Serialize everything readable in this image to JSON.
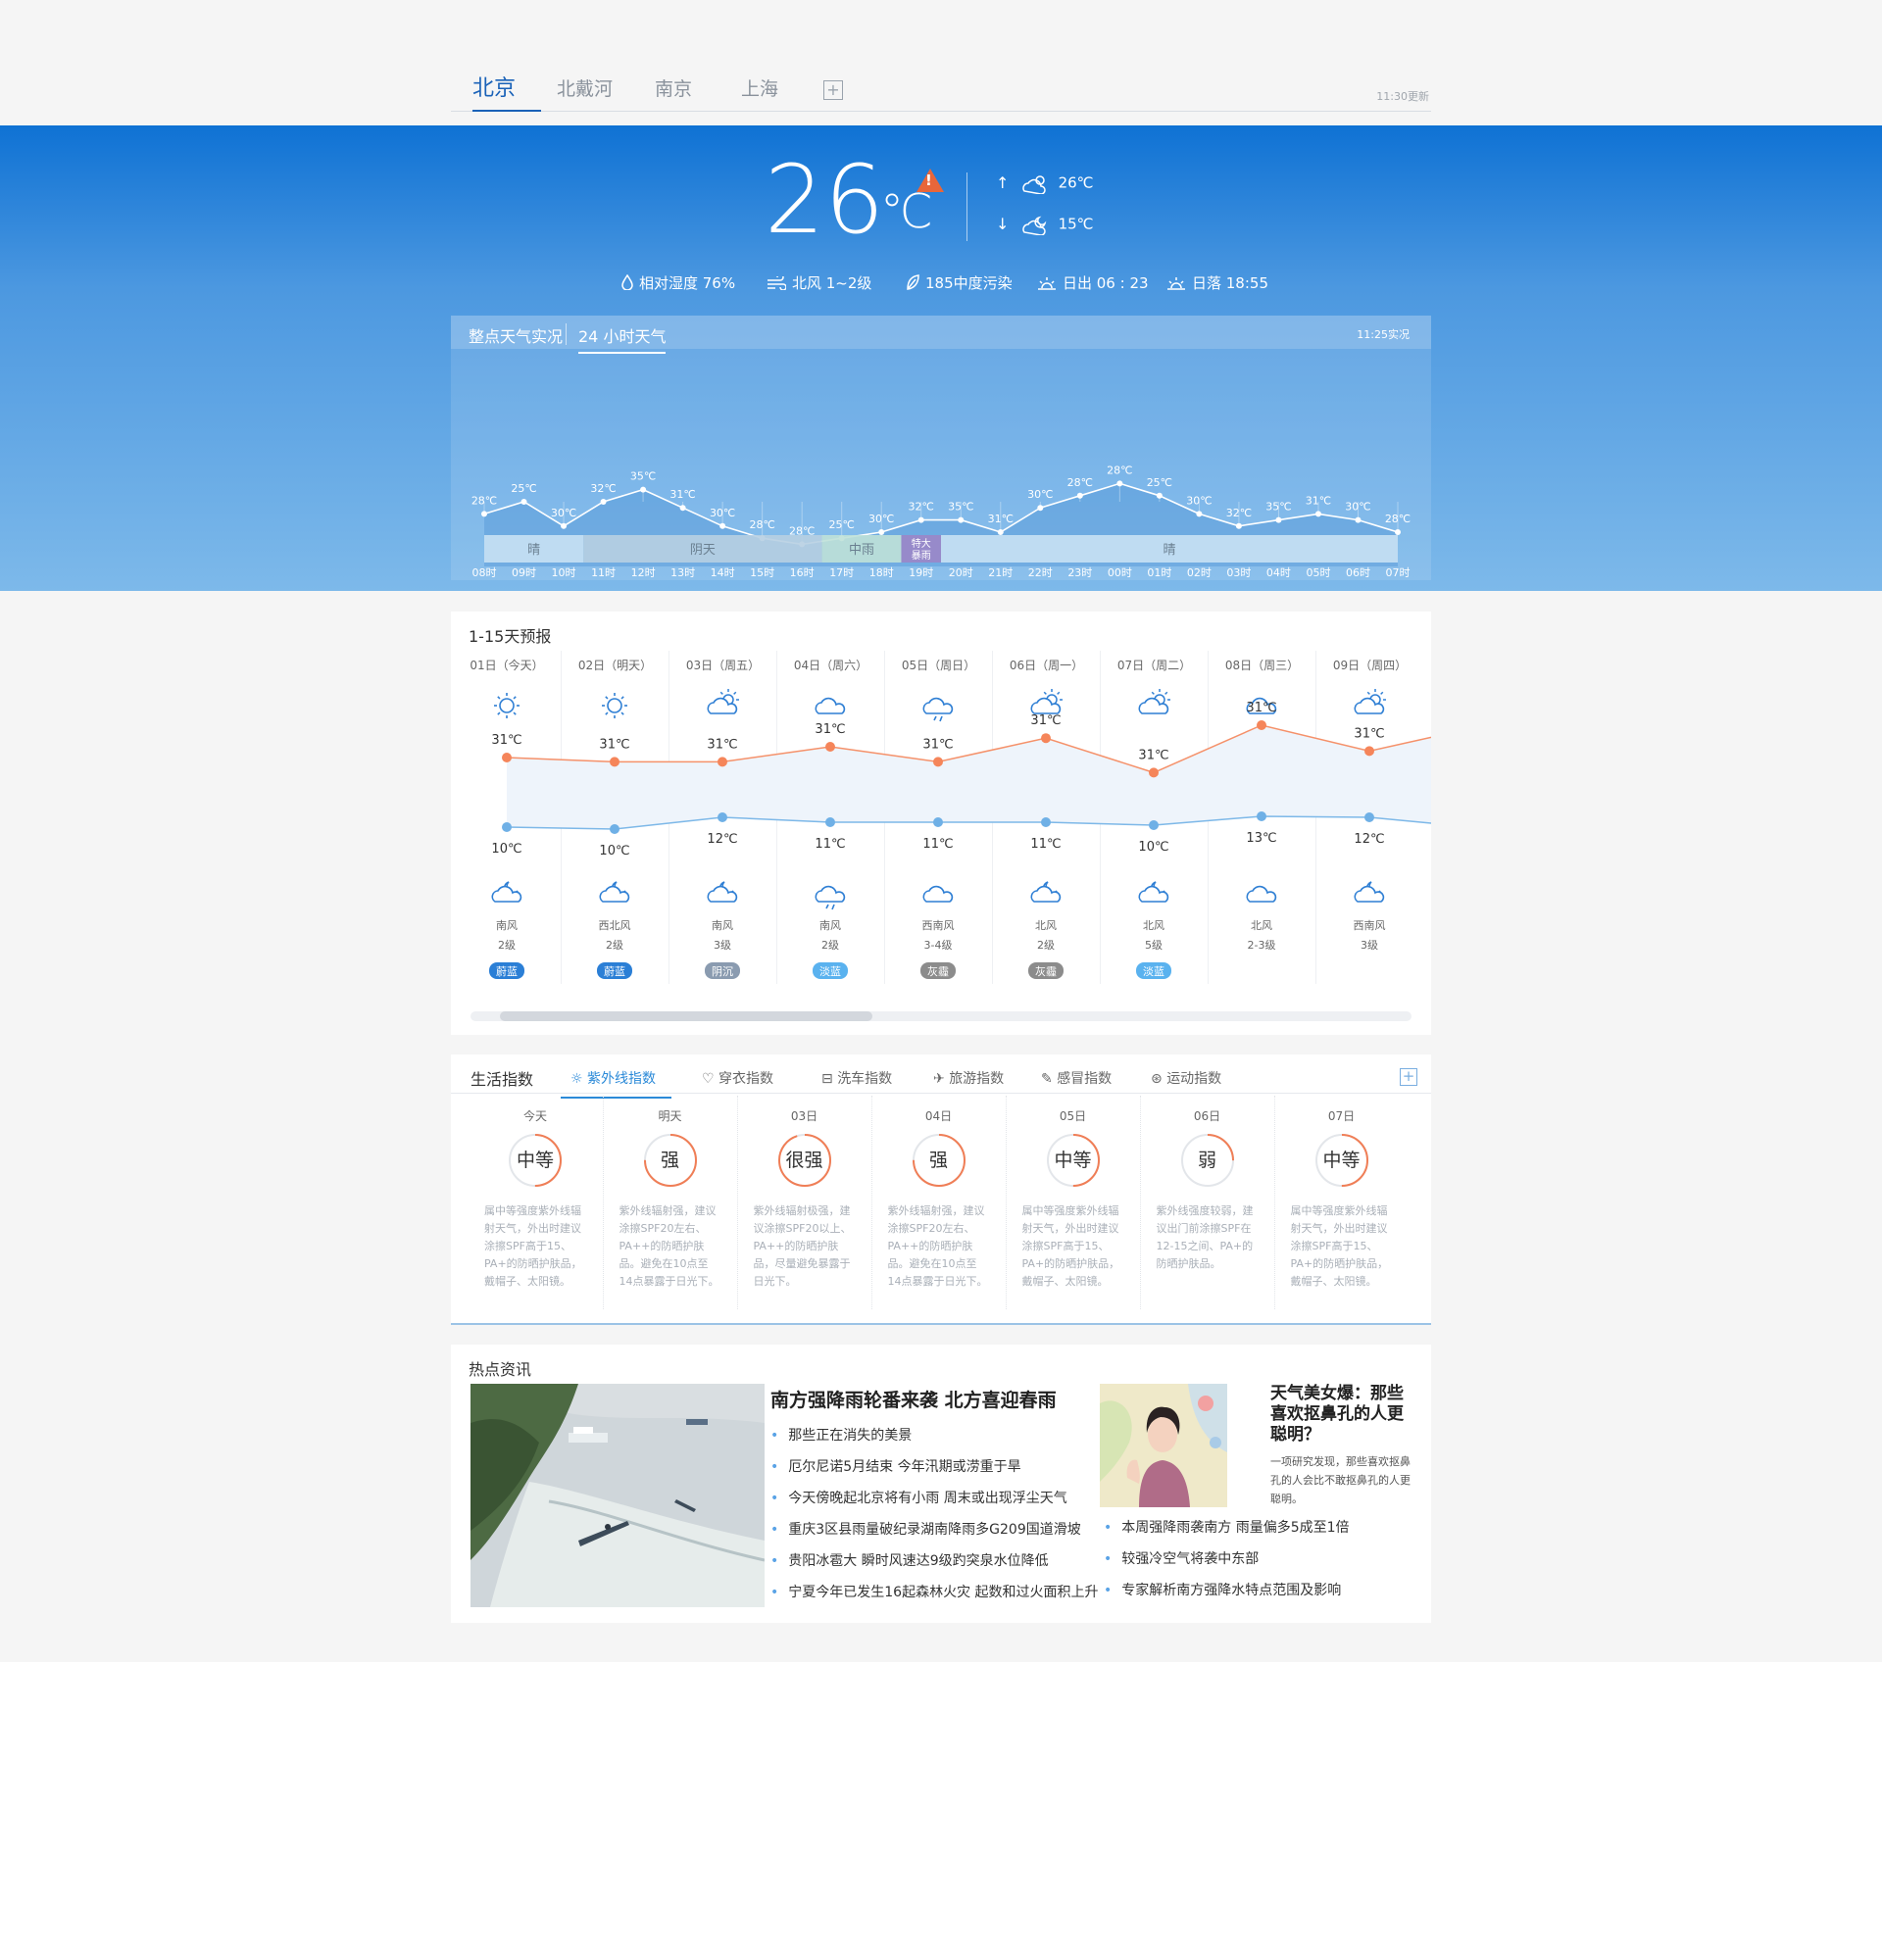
{
  "city_tabs": [
    "北京",
    "北戴河",
    "南京",
    "上海"
  ],
  "updated": "11:30更新",
  "current": {
    "temp": "26",
    "unit": "℃",
    "high": "26℃",
    "low": "15℃"
  },
  "metrics": {
    "humidity": "相对湿度  76%",
    "wind": "北风  1~2级",
    "air": "185中度污染",
    "sunrise": "日出 06 : 23",
    "sunset": "日落 18:55"
  },
  "hourly": {
    "tabs": [
      "整点天气实况",
      "24 小时天气"
    ],
    "observed": "11:25实况",
    "hours": [
      "08时",
      "09时",
      "10时",
      "11时",
      "12时",
      "13时",
      "14时",
      "15时",
      "16时",
      "17时",
      "18时",
      "19时",
      "20时",
      "21时",
      "22时",
      "23时",
      "00时",
      "01时",
      "02时",
      "03时",
      "04时",
      "05时",
      "06时",
      "07时"
    ],
    "temps": [
      28,
      25,
      30,
      32,
      35,
      31,
      30,
      28,
      28,
      25,
      30,
      32,
      35,
      31,
      30,
      28,
      28,
      25,
      30,
      32,
      35,
      31,
      30,
      28
    ],
    "plot_y": [
      28,
      30,
      26,
      30,
      32,
      29,
      26,
      24,
      23,
      24,
      25,
      27,
      27,
      25,
      29,
      31,
      33,
      31,
      28,
      26,
      27,
      28,
      27,
      25
    ],
    "labels": [
      "28℃",
      "25℃",
      "30℃",
      "32℃",
      "35℃",
      "31℃",
      "30℃",
      "28℃",
      "28℃",
      "25℃",
      "30℃",
      "32℃",
      "35℃",
      "31℃",
      "30℃",
      "28℃",
      "28℃",
      "25℃",
      "30℃",
      "32℃",
      "35℃",
      "31℃",
      "30℃",
      "28℃"
    ],
    "conditions": [
      {
        "label": "晴",
        "start": 0,
        "end": 3,
        "color": "#c8e1f4"
      },
      {
        "label": "阴天",
        "start": 3,
        "end": 9,
        "color": "#b7cfe2"
      },
      {
        "label": "中雨",
        "start": 9,
        "end": 11,
        "color": "#bfe1d8"
      },
      {
        "label": "特大暴雨",
        "start": 11,
        "end": 12,
        "color": "#9b86c8"
      },
      {
        "label": "晴",
        "start": 12,
        "end": 24,
        "color": "#c8e1f4"
      }
    ]
  },
  "forecast": {
    "title": "1-15天预报",
    "days": [
      {
        "date": "01日（今天）",
        "day_icon": "sun-icon",
        "high": "31℃",
        "high_v": 31.0,
        "low": "10℃",
        "low_v": 10,
        "night_icon": "cloud-moon-icon",
        "wind": "南风",
        "level": "2级",
        "badge": "蔚蓝",
        "badge_color": "#2b7fd6"
      },
      {
        "date": "02日（明天）",
        "day_icon": "sun-icon",
        "high": "31℃",
        "high_v": 30.6,
        "low": "10℃",
        "low_v": 9.6,
        "night_icon": "cloud-moon-icon",
        "wind": "西北风",
        "level": "2级",
        "badge": "蔚蓝",
        "badge_color": "#2b7fd6"
      },
      {
        "date": "03日（周五）",
        "day_icon": "partly-cloudy-icon",
        "high": "31℃",
        "high_v": 30.6,
        "low": "12℃",
        "low_v": 12,
        "night_icon": "cloud-moon-icon",
        "wind": "南风",
        "level": "3级",
        "badge": "阴沉",
        "badge_color": "#8a9bb0"
      },
      {
        "date": "04日（周六）",
        "day_icon": "cloud-icon",
        "high": "31℃",
        "high_v": 32,
        "low": "11℃",
        "low_v": 11,
        "night_icon": "rain-icon",
        "wind": "南风",
        "level": "2级",
        "badge": "淡蓝",
        "badge_color": "#5ab2ef"
      },
      {
        "date": "05日（周日）",
        "day_icon": "rain-icon",
        "high": "31℃",
        "high_v": 30.6,
        "low": "11℃",
        "low_v": 11,
        "night_icon": "cloud-icon",
        "wind": "西南风",
        "level": "3-4级",
        "badge": "灰霾",
        "badge_color": "#8c8c8c"
      },
      {
        "date": "06日（周一）",
        "day_icon": "partly-cloudy-icon",
        "high": "31℃",
        "high_v": 32.8,
        "low": "11℃",
        "low_v": 11,
        "night_icon": "cloud-moon-icon",
        "wind": "北风",
        "level": "2级",
        "badge": "灰霾",
        "badge_color": "#8c8c8c"
      },
      {
        "date": "07日（周二）",
        "day_icon": "partly-cloudy-icon",
        "high": "31℃",
        "high_v": 29.6,
        "low": "10℃",
        "low_v": 10.4,
        "night_icon": "cloud-moon-icon",
        "wind": "北风",
        "level": "5级",
        "badge": "淡蓝",
        "badge_color": "#5ab2ef"
      },
      {
        "date": "08日（周三）",
        "day_icon": "cloud-icon",
        "high": "31℃",
        "high_v": 34,
        "low": "13℃",
        "low_v": 12.2,
        "night_icon": "cloud-icon",
        "wind": "北风",
        "level": "2-3级",
        "badge": "",
        "badge_color": ""
      },
      {
        "date": "09日（周四）",
        "day_icon": "partly-cloudy-icon",
        "high": "31℃",
        "high_v": 31.6,
        "low": "12℃",
        "low_v": 12,
        "night_icon": "cloud-moon-icon",
        "wind": "西南风",
        "level": "3级",
        "badge": "",
        "badge_color": ""
      }
    ]
  },
  "life": {
    "title": "生活指数",
    "tabs": [
      "紫外线指数",
      "穿衣指数",
      "洗车指数",
      "旅游指数",
      "感冒指数",
      "运动指数"
    ],
    "items": [
      {
        "day": "今天",
        "level": "中等",
        "fill": 0.5,
        "desc": "属中等强度紫外线辐射天气，外出时建议涂擦SPF高于15、PA+的防晒护肤品，戴帽子、太阳镜。"
      },
      {
        "day": "明天",
        "level": "强",
        "fill": 0.75,
        "desc": "紫外线辐射强，建议涂擦SPF20左右、PA++的防晒护肤品。避免在10点至14点暴露于日光下。"
      },
      {
        "day": "03日",
        "level": "很强",
        "fill": 0.95,
        "desc": "紫外线辐射极强，建议涂擦SPF20以上、PA++的防晒护肤品，尽量避免暴露于日光下。"
      },
      {
        "day": "04日",
        "level": "强",
        "fill": 0.75,
        "desc": "紫外线辐射强，建议涂擦SPF20左右、PA++的防晒护肤品。避免在10点至14点暴露于日光下。"
      },
      {
        "day": "05日",
        "level": "中等",
        "fill": 0.5,
        "desc": "属中等强度紫外线辐射天气，外出时建议涂擦SPF高于15、PA+的防晒护肤品，戴帽子、太阳镜。"
      },
      {
        "day": "06日",
        "level": "弱",
        "fill": 0.25,
        "desc": "紫外线强度较弱，建议出门前涂擦SPF在12-15之间、PA+的防晒护肤品。"
      },
      {
        "day": "07日",
        "level": "中等",
        "fill": 0.5,
        "desc": "属中等强度紫外线辐射天气，外出时建议涂擦SPF高于15、PA+的防晒护肤品，戴帽子、太阳镜。"
      }
    ]
  },
  "news": {
    "title": "热点资讯",
    "headline": "南方强降雨轮番来袭 北方喜迎春雨",
    "items": [
      "那些正在消失的美景",
      "厄尔尼诺5月结束 今年汛期或涝重于旱",
      "今天傍晚起北京将有小雨 周末或出现浮尘天气",
      "重庆3区县雨量破纪录湖南降雨多G209国道滑坡",
      "贵阳冰雹大 瞬时风速达9级趵突泉水位降低",
      "宁夏今年已发生16起森林火灾 起数和过火面积上升"
    ],
    "feature_title": "天气美女爆：那些喜欢抠鼻孔的人更聪明？",
    "feature_desc": "一项研究发现，那些喜欢抠鼻孔的人会比不敢抠鼻孔的人更聪明。",
    "side_items": [
      "本周强降雨袭南方 雨量偏多5成至1倍",
      "较强冷空气将袭中东部",
      "专家解析南方强降水特点范围及影响"
    ]
  }
}
